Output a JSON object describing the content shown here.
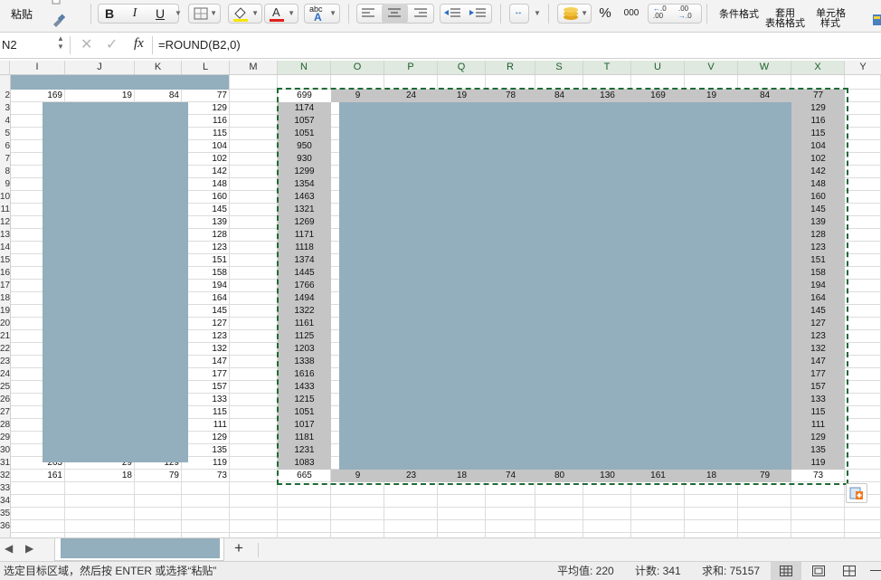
{
  "ribbon": {
    "paste_label": "粘贴",
    "bold": "B",
    "italic": "I",
    "underline": "U",
    "spell": "abc",
    "percent": "%",
    "thousands": "000",
    "conditional_format": "条件格式",
    "table_format_line1": "套用",
    "table_format_line2": "表格格式",
    "cell_style_line1": "单元格",
    "cell_style_line2": "样式",
    "colors": {
      "highlight": "#f7e600",
      "font": "#e0201a"
    }
  },
  "formula_bar": {
    "name_box": "N2",
    "fx": "fx",
    "formula": "=ROUND(B2,0)"
  },
  "left_columns": [
    "I",
    "J",
    "K",
    "L",
    "M"
  ],
  "right_columns": [
    "N",
    "O",
    "P",
    "Q",
    "R",
    "S",
    "T",
    "U",
    "V",
    "W",
    "X",
    "Y"
  ],
  "row_numbers": [
    "2",
    "3",
    "4",
    "5",
    "6",
    "7",
    "8",
    "9",
    "10",
    "11",
    "12",
    "13",
    "14",
    "15",
    "16",
    "17",
    "18",
    "19",
    "20",
    "21",
    "22",
    "23",
    "24",
    "25",
    "26",
    "27",
    "28",
    "29",
    "30",
    "31",
    "32",
    "33",
    "34",
    "35",
    "36"
  ],
  "left_row2": [
    "169",
    "19",
    "84",
    "77"
  ],
  "left_row31": [
    "263",
    "29",
    "129",
    "119"
  ],
  "left_row32": [
    "161",
    "18",
    "79",
    "73"
  ],
  "left_L_values": [
    "129",
    "116",
    "115",
    "104",
    "102",
    "142",
    "148",
    "160",
    "145",
    "139",
    "128",
    "123",
    "151",
    "158",
    "194",
    "164",
    "145",
    "127",
    "123",
    "132",
    "147",
    "177",
    "157",
    "133",
    "115",
    "111",
    "129",
    "135"
  ],
  "n_values": [
    "699",
    "1174",
    "1057",
    "1051",
    "950",
    "930",
    "1299",
    "1354",
    "1463",
    "1321",
    "1269",
    "1171",
    "1118",
    "1374",
    "1445",
    "1766",
    "1494",
    "1322",
    "1161",
    "1125",
    "1203",
    "1338",
    "1616",
    "1433",
    "1215",
    "1051",
    "1017",
    "1181",
    "1231",
    "1083",
    "665"
  ],
  "x_values": [
    "77",
    "129",
    "116",
    "115",
    "104",
    "102",
    "142",
    "148",
    "160",
    "145",
    "139",
    "128",
    "123",
    "151",
    "158",
    "194",
    "164",
    "145",
    "127",
    "123",
    "132",
    "147",
    "177",
    "157",
    "133",
    "115",
    "111",
    "129",
    "135",
    "119",
    "73"
  ],
  "top_row_values": [
    "9",
    "24",
    "19",
    "78",
    "84",
    "136",
    "169",
    "19",
    "84"
  ],
  "bottom_row_values": [
    "9",
    "23",
    "18",
    "74",
    "80",
    "130",
    "161",
    "18",
    "79"
  ],
  "status": {
    "message": "选定目标区域，然后按 ENTER 或选择“粘贴”",
    "average": "平均值: 220",
    "count": "计数: 341",
    "sum": "求和: 75157"
  },
  "tabs": {
    "add": "+"
  }
}
